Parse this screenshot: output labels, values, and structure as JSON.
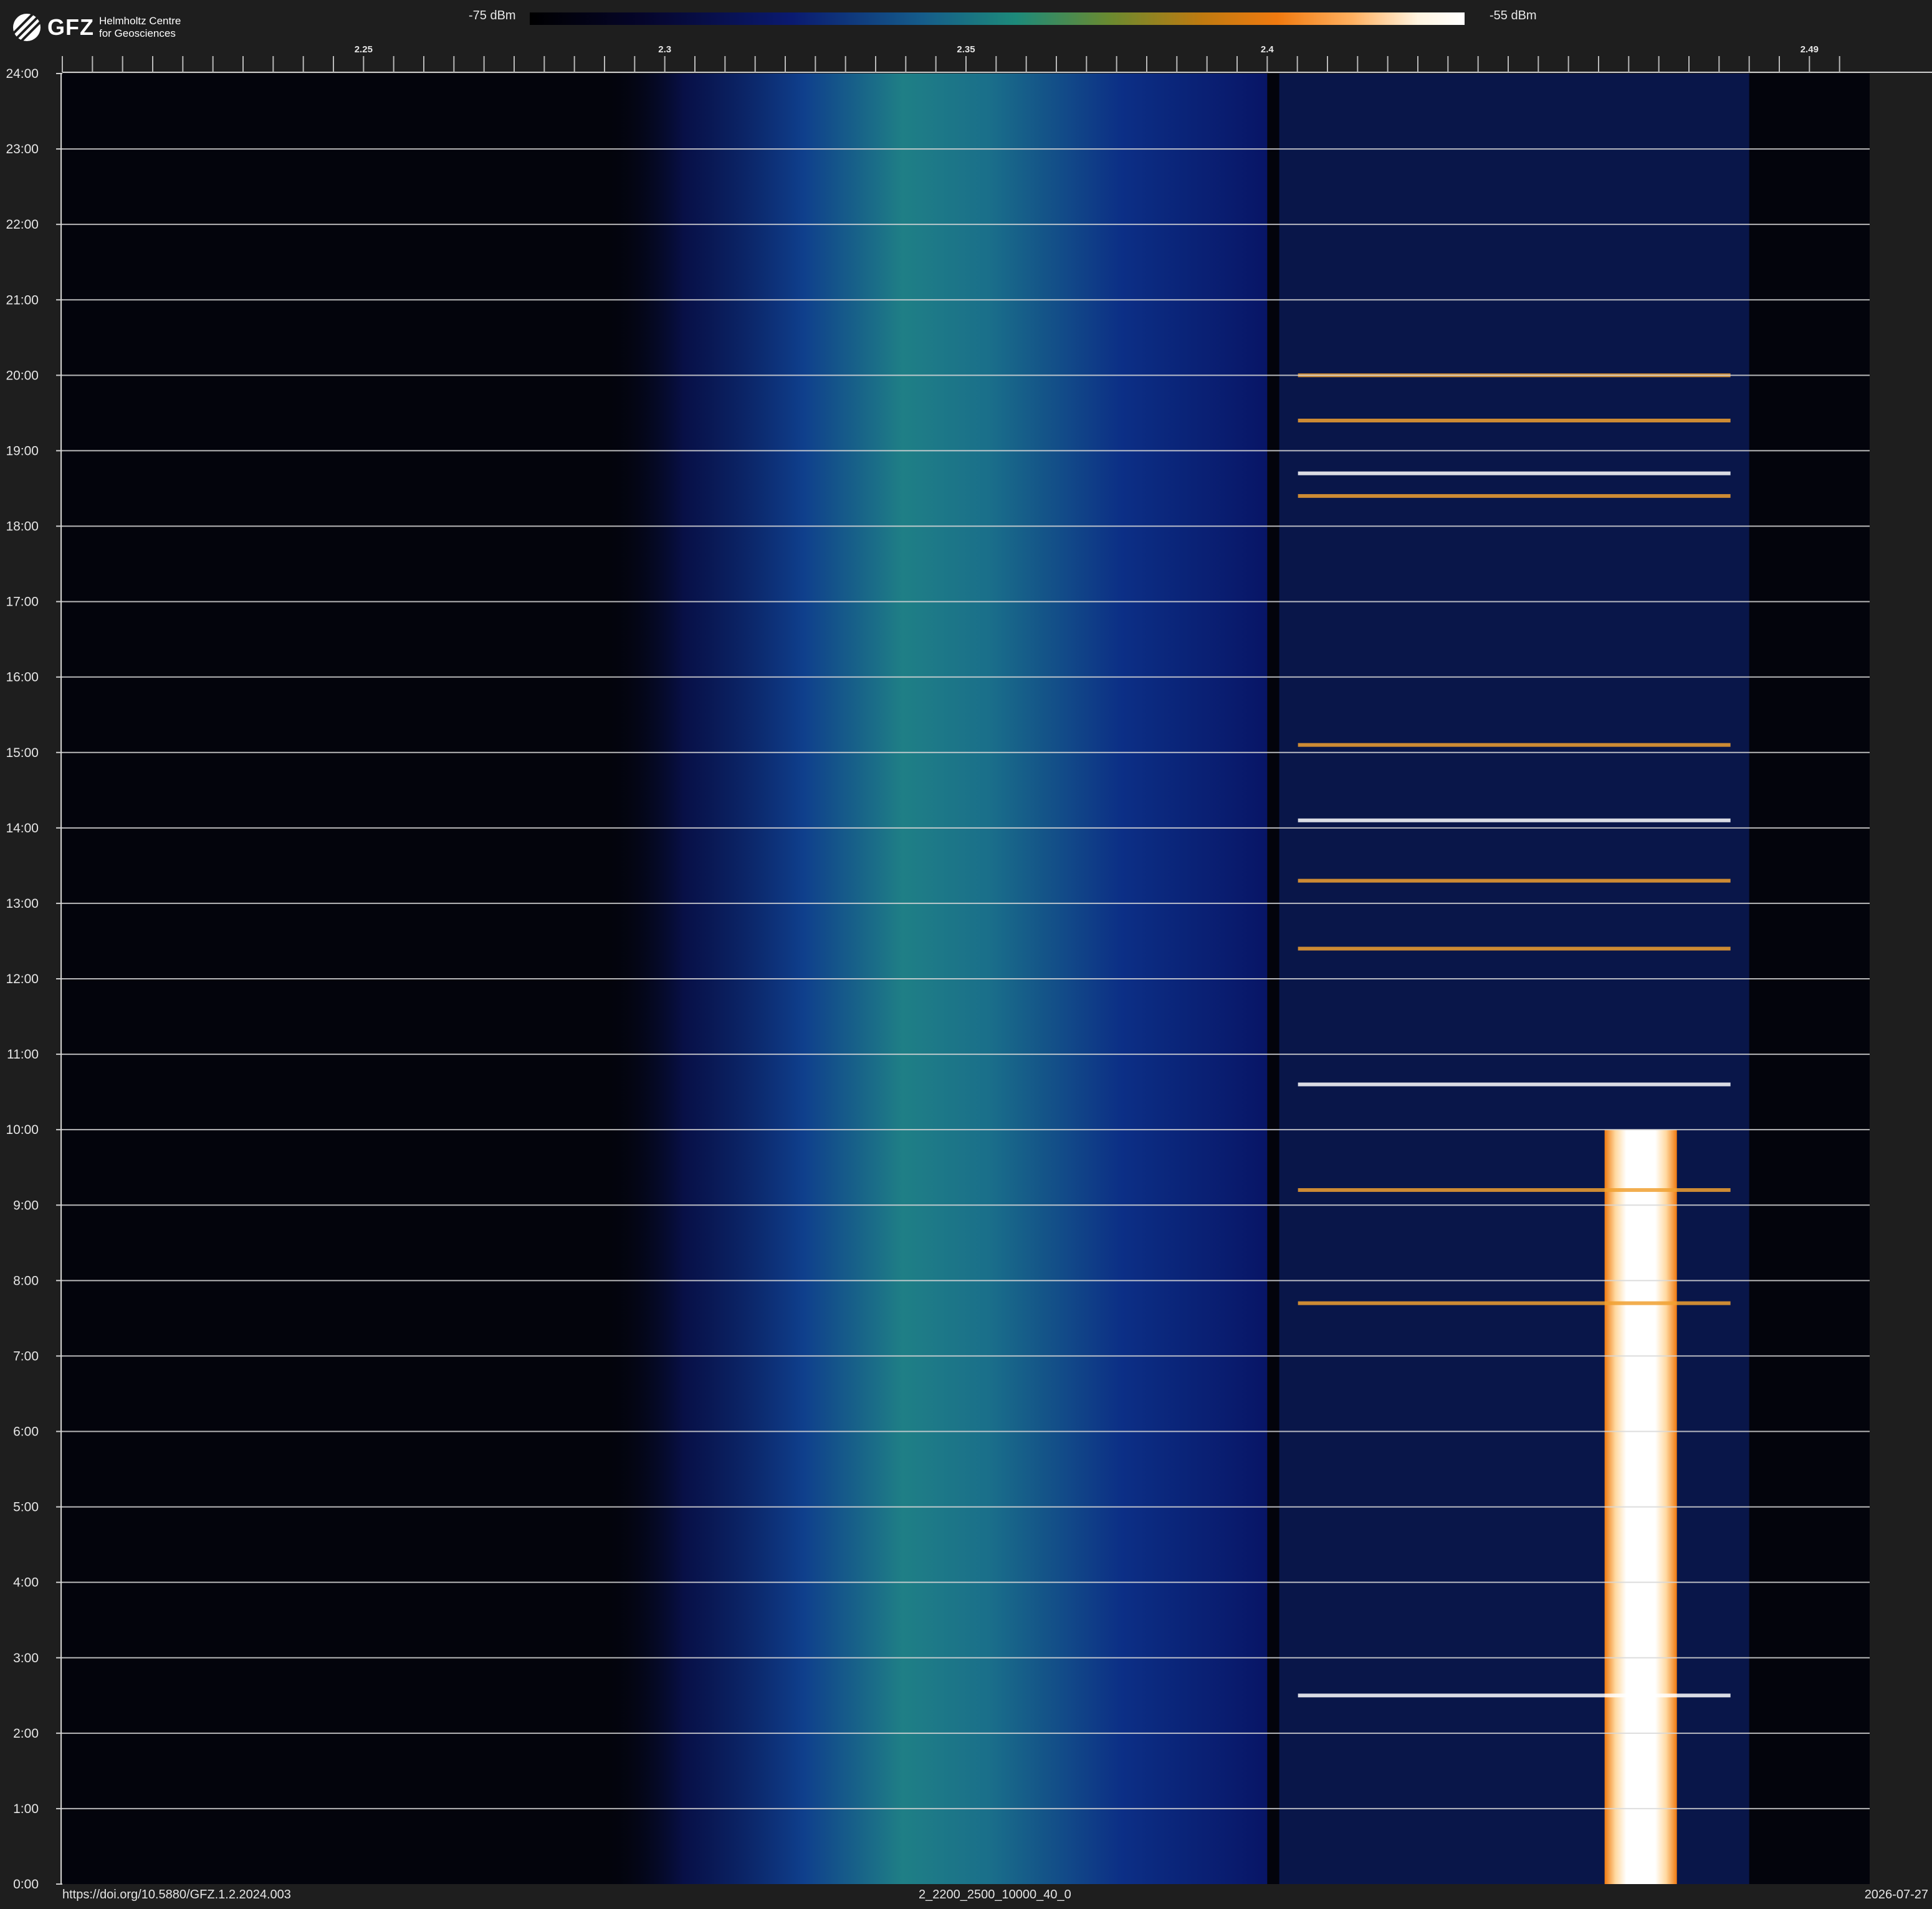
{
  "chart_data": {
    "type": "heatmap",
    "title": "",
    "xlabel": "",
    "ylabel": "",
    "x_range": [
      2.2,
      2.5
    ],
    "x_ticks": [
      {
        "value": 2.25,
        "label": "2.25"
      },
      {
        "value": 2.3,
        "label": "2.3"
      },
      {
        "value": 2.35,
        "label": "2.35"
      },
      {
        "value": 2.4,
        "label": "2.4"
      },
      {
        "value": 2.49,
        "label": "2.49"
      }
    ],
    "y_range_hours": [
      0,
      24
    ],
    "y_ticks": [
      "0:00",
      "1:00",
      "2:00",
      "3:00",
      "4:00",
      "5:00",
      "6:00",
      "7:00",
      "8:00",
      "9:00",
      "10:00",
      "11:00",
      "12:00",
      "13:00",
      "14:00",
      "15:00",
      "16:00",
      "17:00",
      "18:00",
      "19:00",
      "20:00",
      "21:00",
      "22:00",
      "23:00",
      "24:00"
    ],
    "colorbar": {
      "min_label": "-75 dBm",
      "max_label": "-55 dBm",
      "colors": [
        "#000000",
        "#0a1a70",
        "#1d8a7a",
        "#c07a10",
        "#f07a10",
        "#ffffff"
      ]
    },
    "grid": true,
    "bands": [
      {
        "name": "broadband",
        "x_from": 2.29,
        "x_to": 2.4,
        "peak_x": 2.335,
        "level": 0.45
      },
      {
        "name": "ism-dense",
        "x_from": 2.402,
        "x_to": 2.48,
        "level": 0.55
      },
      {
        "name": "strong-source",
        "x_from": 2.456,
        "x_to": 2.468,
        "hours_from": 0,
        "hours_to": 10,
        "level": 1.0
      }
    ],
    "bursts_hours": [
      2.5,
      7.7,
      9.2,
      10.6,
      12.4,
      13.3,
      14.1,
      15.1,
      18.4,
      18.7,
      19.4,
      20.0
    ]
  },
  "footer": {
    "doi": "https://doi.org/10.5880/GFZ.1.2.2024.003",
    "code": "2_2200_2500_10000_40_0",
    "date": "2026-07-27"
  },
  "logo": {
    "name": "GFZ",
    "line1": "Helmholtz Centre",
    "line2": "for Geosciences"
  },
  "colors": {
    "background": "#1e1e1e",
    "plot_bg": "#03040c",
    "gridline": "#d8d8d8"
  }
}
